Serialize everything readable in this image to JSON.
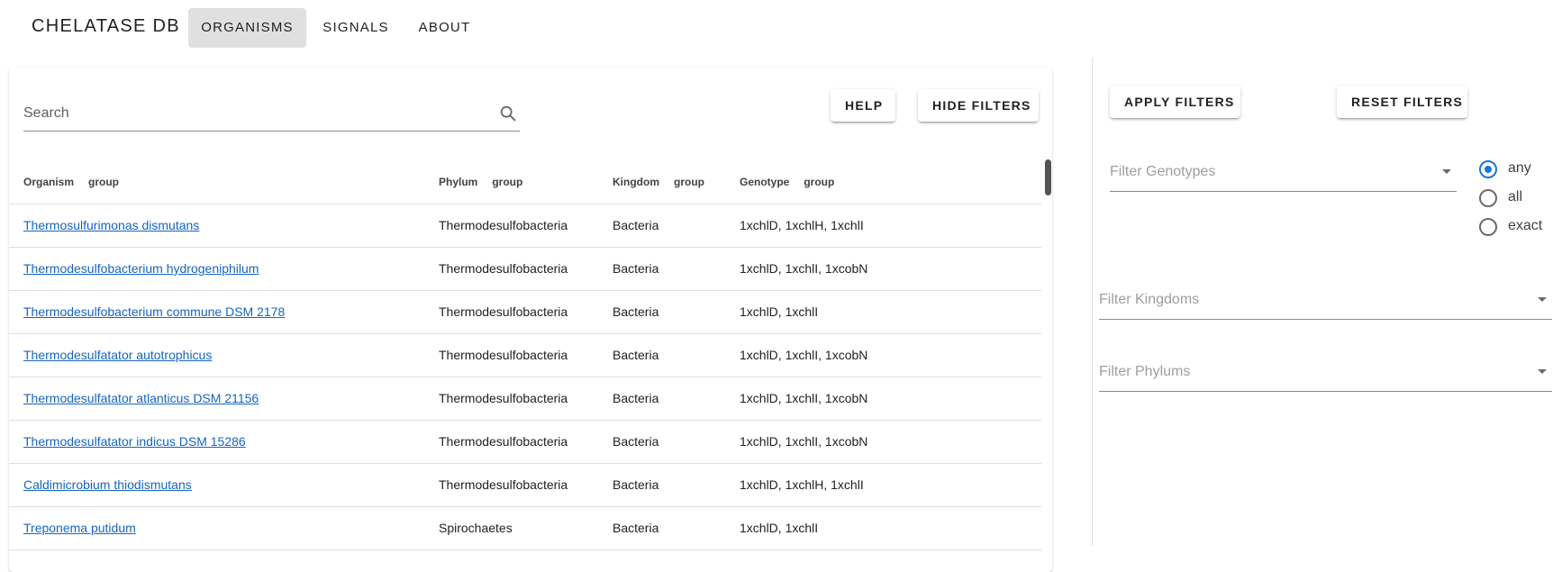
{
  "app": {
    "title": "CHELATASE DB"
  },
  "nav": {
    "tabs": [
      {
        "label": "ORGANISMS",
        "active": true
      },
      {
        "label": "SIGNALS",
        "active": false
      },
      {
        "label": "ABOUT",
        "active": false
      }
    ]
  },
  "toolbar": {
    "search_placeholder": "Search",
    "help_label": "HELP",
    "hide_filters_label": "HIDE FILTERS"
  },
  "table": {
    "columns": [
      {
        "label": "Organism",
        "group": "group"
      },
      {
        "label": "Phylum",
        "group": "group"
      },
      {
        "label": "Kingdom",
        "group": "group"
      },
      {
        "label": "Genotype",
        "group": "group"
      }
    ],
    "rows": [
      {
        "organism": "Thermosulfurimonas dismutans",
        "phylum": "Thermodesulfobacteria",
        "kingdom": "Bacteria",
        "genotype": "1xchlD, 1xchlH, 1xchlI"
      },
      {
        "organism": "Thermodesulfobacterium hydrogeniphilum",
        "phylum": "Thermodesulfobacteria",
        "kingdom": "Bacteria",
        "genotype": "1xchlD, 1xchlI, 1xcobN"
      },
      {
        "organism": "Thermodesulfobacterium commune DSM 2178",
        "phylum": "Thermodesulfobacteria",
        "kingdom": "Bacteria",
        "genotype": "1xchlD, 1xchlI"
      },
      {
        "organism": "Thermodesulfatator autotrophicus",
        "phylum": "Thermodesulfobacteria",
        "kingdom": "Bacteria",
        "genotype": "1xchlD, 1xchlI, 1xcobN"
      },
      {
        "organism": "Thermodesulfatator atlanticus DSM 21156",
        "phylum": "Thermodesulfobacteria",
        "kingdom": "Bacteria",
        "genotype": "1xchlD, 1xchlI, 1xcobN"
      },
      {
        "organism": "Thermodesulfatator indicus DSM 15286",
        "phylum": "Thermodesulfobacteria",
        "kingdom": "Bacteria",
        "genotype": "1xchlD, 1xchlI, 1xcobN"
      },
      {
        "organism": "Caldimicrobium thiodismutans",
        "phylum": "Thermodesulfobacteria",
        "kingdom": "Bacteria",
        "genotype": "1xchlD, 1xchlH, 1xchlI"
      },
      {
        "organism": "Treponema putidum",
        "phylum": "Spirochaetes",
        "kingdom": "Bacteria",
        "genotype": "1xchlD, 1xchlI"
      }
    ]
  },
  "filters": {
    "apply_label": "APPLY FILTERS",
    "reset_label": "RESET FILTERS",
    "genotypes_placeholder": "Filter Genotypes",
    "kingdoms_placeholder": "Filter Kingdoms",
    "phylums_placeholder": "Filter Phylums",
    "match_options": [
      {
        "label": "any",
        "checked": true
      },
      {
        "label": "all",
        "checked": false
      },
      {
        "label": "exact",
        "checked": false
      }
    ]
  },
  "colors": {
    "accent": "#1976d2",
    "link": "#1565c0",
    "active_tab_bg": "#e0e0e0"
  },
  "icons": {
    "search": "search-icon",
    "dropdown": "dropdown-caret-icon"
  }
}
